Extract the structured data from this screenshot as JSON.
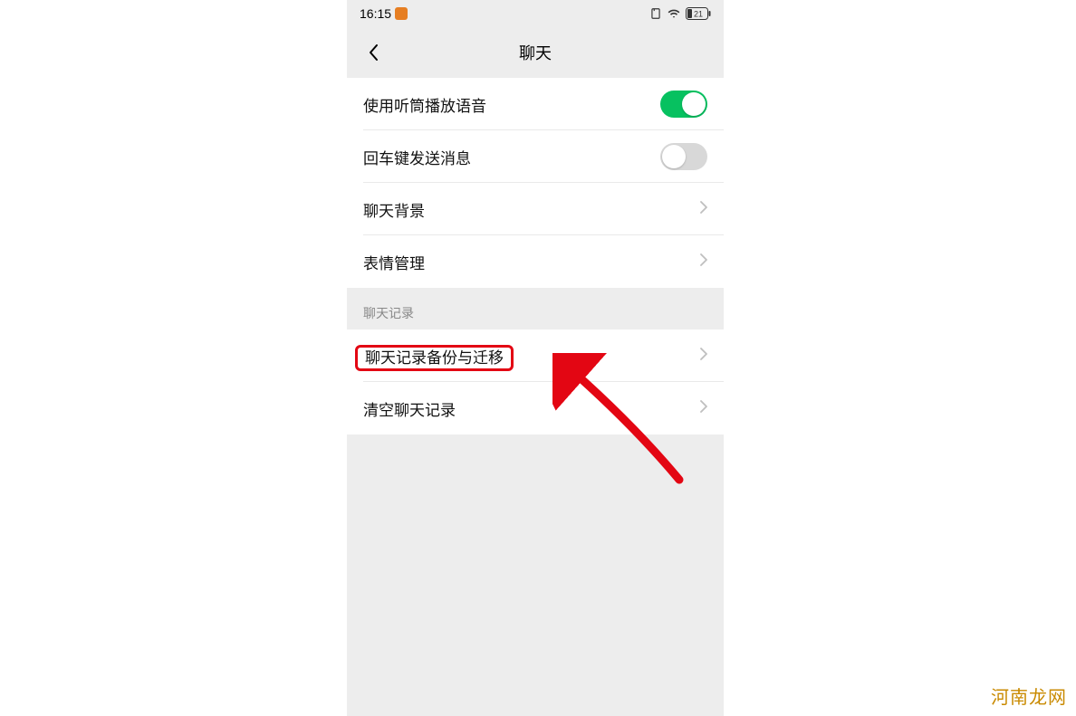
{
  "status": {
    "time": "16:15",
    "battery": "21"
  },
  "nav": {
    "title": "聊天"
  },
  "rows": {
    "earpiece": {
      "label": "使用听筒播放语音",
      "on": true
    },
    "enter_send": {
      "label": "回车键发送消息",
      "on": false
    },
    "background": {
      "label": "聊天背景"
    },
    "stickers": {
      "label": "表情管理"
    }
  },
  "section": {
    "history_header": "聊天记录",
    "backup": {
      "label": "聊天记录备份与迁移"
    },
    "clear": {
      "label": "清空聊天记录"
    }
  },
  "watermark": "河南龙网",
  "colors": {
    "accent_green": "#07c160",
    "annotation_red": "#e30613"
  }
}
